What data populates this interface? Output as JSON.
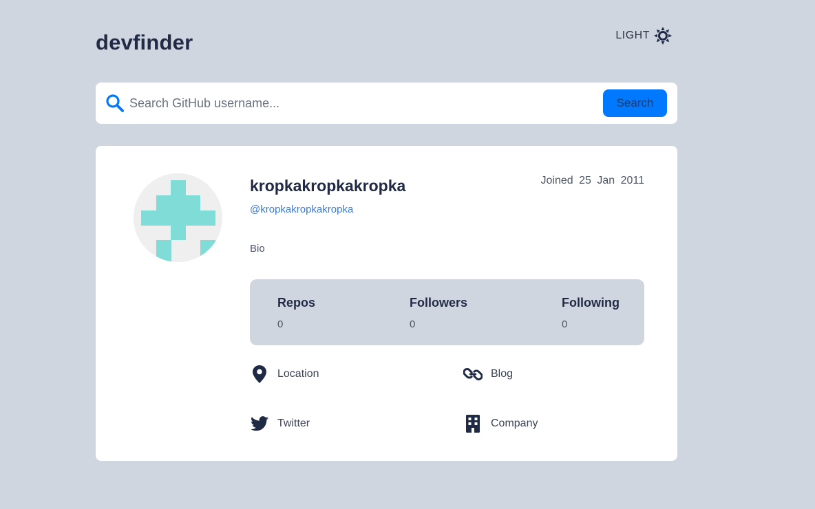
{
  "app": {
    "title": "devfinder"
  },
  "theme": {
    "label": "LIGHT",
    "icon": "sun-icon"
  },
  "search": {
    "placeholder": "Search GitHub username...",
    "value": "",
    "button_label": "Search",
    "icon": "search-icon"
  },
  "profile": {
    "name": "kropkakropkakropka",
    "login": "@kropkakropkakropka",
    "joined": "Joined 25 Jan 2011",
    "bio": "Bio",
    "stats": {
      "repos": {
        "label": "Repos",
        "value": "0"
      },
      "followers": {
        "label": "Followers",
        "value": "0"
      },
      "following": {
        "label": "Following",
        "value": "0"
      }
    },
    "links": {
      "location": {
        "label": "Location",
        "icon": "location-pin-icon"
      },
      "blog": {
        "label": "Blog",
        "icon": "link-icon"
      },
      "twitter": {
        "label": "Twitter",
        "icon": "twitter-icon"
      },
      "company": {
        "label": "Company",
        "icon": "building-icon"
      }
    }
  },
  "colors": {
    "background": "#cfd6df",
    "card": "#ffffff",
    "accent": "#0079ff",
    "link": "#3b7bd8",
    "text_dark": "#222b45",
    "avatar_pattern": "#7fdcd6"
  }
}
